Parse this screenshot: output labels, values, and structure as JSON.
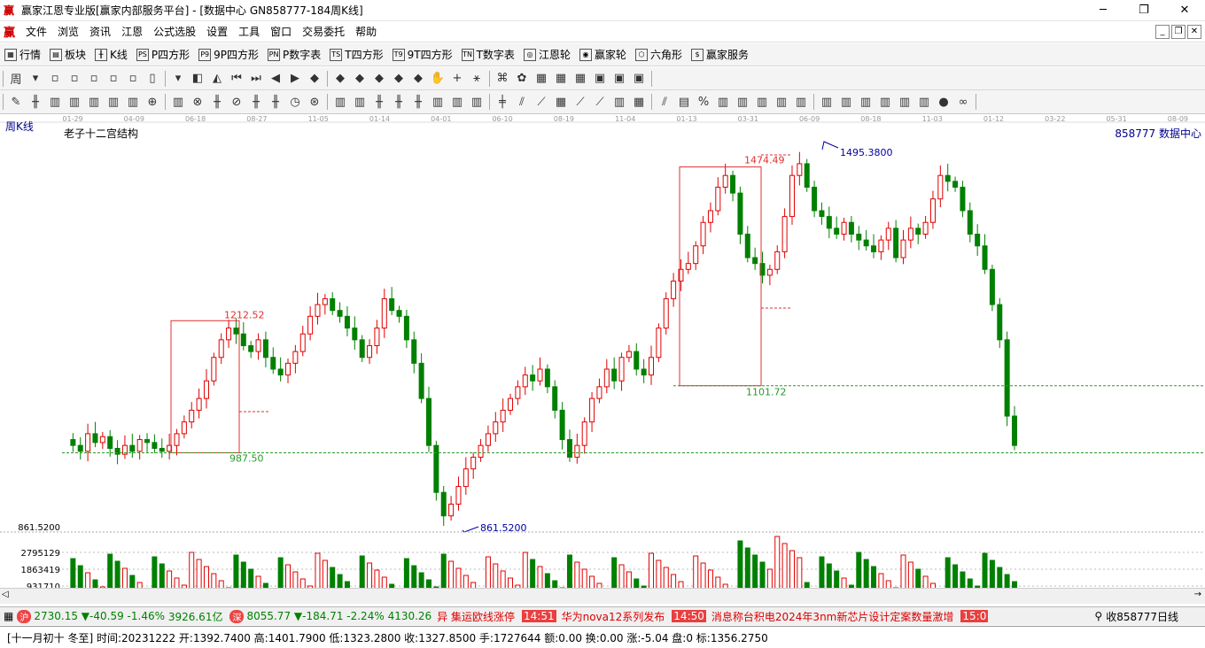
{
  "window": {
    "title": "赢家江恩专业版[赢家内部服务平台] - [数据中心  GN858777-184周K线]",
    "icon": "yingjia-logo-icon",
    "controls": [
      "─",
      "❐",
      "✕"
    ]
  },
  "menu": {
    "logo": "赢",
    "items": [
      "文件",
      "浏览",
      "资讯",
      "江恩",
      "公式选股",
      "设置",
      "工具",
      "窗口",
      "交易委托",
      "帮助"
    ],
    "mdi": [
      "_",
      "❐",
      "✕"
    ]
  },
  "toolbar1": [
    {
      "icon": "▦",
      "label": "行情"
    },
    {
      "icon": "▤",
      "label": "板块"
    },
    {
      "icon": "╫",
      "label": "K线"
    },
    {
      "icon": "PS",
      "label": "P四方形"
    },
    {
      "icon": "P9",
      "label": "9P四方形"
    },
    {
      "icon": "PN",
      "label": "P数字表"
    },
    {
      "icon": "TS",
      "label": "T四方形"
    },
    {
      "icon": "T9",
      "label": "9T四方形"
    },
    {
      "icon": "TN",
      "label": "T数字表"
    },
    {
      "icon": "◎",
      "label": "江恩轮"
    },
    {
      "icon": "◉",
      "label": "赢家轮"
    },
    {
      "icon": "⬡",
      "label": "六角形"
    },
    {
      "icon": "$",
      "label": "赢家服务"
    }
  ],
  "toolbar2_icons": [
    "周",
    "▾",
    "▫",
    "▫",
    "▫",
    "▫",
    "▫",
    "▯",
    "▾",
    "◧",
    "◭",
    "⏮",
    "⏭",
    "◀",
    "▶",
    "◆",
    "◆",
    "◆",
    "◆",
    "◆",
    "◆",
    "✋",
    "+",
    "⚹",
    "⌘",
    "✿",
    "▦",
    "▦",
    "▦",
    "▣",
    "▣",
    "▣"
  ],
  "toolbar3_icons": [
    "✎",
    "╫",
    "▥",
    "▥",
    "▥",
    "▥",
    "▥",
    "⊕",
    "▥",
    "⊗",
    "╫",
    "⊘",
    "╫",
    "╫",
    "◷",
    "⊛",
    "▥",
    "▥",
    "╫",
    "╫",
    "╫",
    "▥",
    "▥",
    "▥",
    "╪",
    "⫽",
    "⟋",
    "▦",
    "⟋",
    "⟋",
    "▥",
    "▦",
    "⫽",
    "▤",
    "%",
    "▥",
    "▥",
    "▥",
    "▥",
    "▥",
    "▥",
    "▥",
    "▥",
    "▥",
    "▥",
    "▥",
    "●",
    "∞"
  ],
  "chart": {
    "period_label": "周K线",
    "indicator_title": "老子十二宫结构",
    "security_label": "858777 数据中心",
    "date_ticks": [
      "01-29",
      "04-09",
      "06-18",
      "08-27",
      "11-05",
      "01-14",
      "04-01",
      "06-10",
      "08-19",
      "11-04",
      "01-13",
      "03-31",
      "06-09",
      "08-18",
      "11-03",
      "01-12",
      "03-22",
      "05-31",
      "08-09"
    ],
    "annotations": {
      "box1_high": "1212.52",
      "box1_low": "987.50",
      "box2_high": "1474.49",
      "box2_low": "1101.72",
      "peak": "1495.3800",
      "trough": "861.5200"
    },
    "volume_axis": [
      "861.5200",
      "2795129",
      "1863419",
      "931710"
    ],
    "colors": {
      "up": "#e00000",
      "down": "#008000",
      "box": "#e03030",
      "dashed": "#2a9a2a",
      "annot_blue": "#0000a0"
    }
  },
  "status": {
    "idx1_value": "2730.15",
    "idx1_change": "▼-40.59",
    "idx1_pct": "-1.46%",
    "idx1_amount": "3926.61亿",
    "idx2_value": "8055.77",
    "idx2_change": "▼-184.71",
    "idx2_pct": "-2.24%",
    "idx2_amount": "4130.26",
    "news": [
      {
        "time": "",
        "text": "异 集运欧线涨停"
      },
      {
        "time": "14:51",
        "text": "华为nova12系列发布"
      },
      {
        "time": "14:50",
        "text": "消息称台积电2024年3nm新芯片设计定案数量激增"
      },
      {
        "time": "15:0",
        "text": ""
      }
    ],
    "right_label": "收858777日线"
  },
  "info": "[十一月初十 冬至] 时间:20231222 开:1392.7400 高:1401.7900 低:1323.2800 收:1327.8500 手:1727644 额:0.00 换:0.00 涨:-5.04 盘:0 标:1356.2750"
}
